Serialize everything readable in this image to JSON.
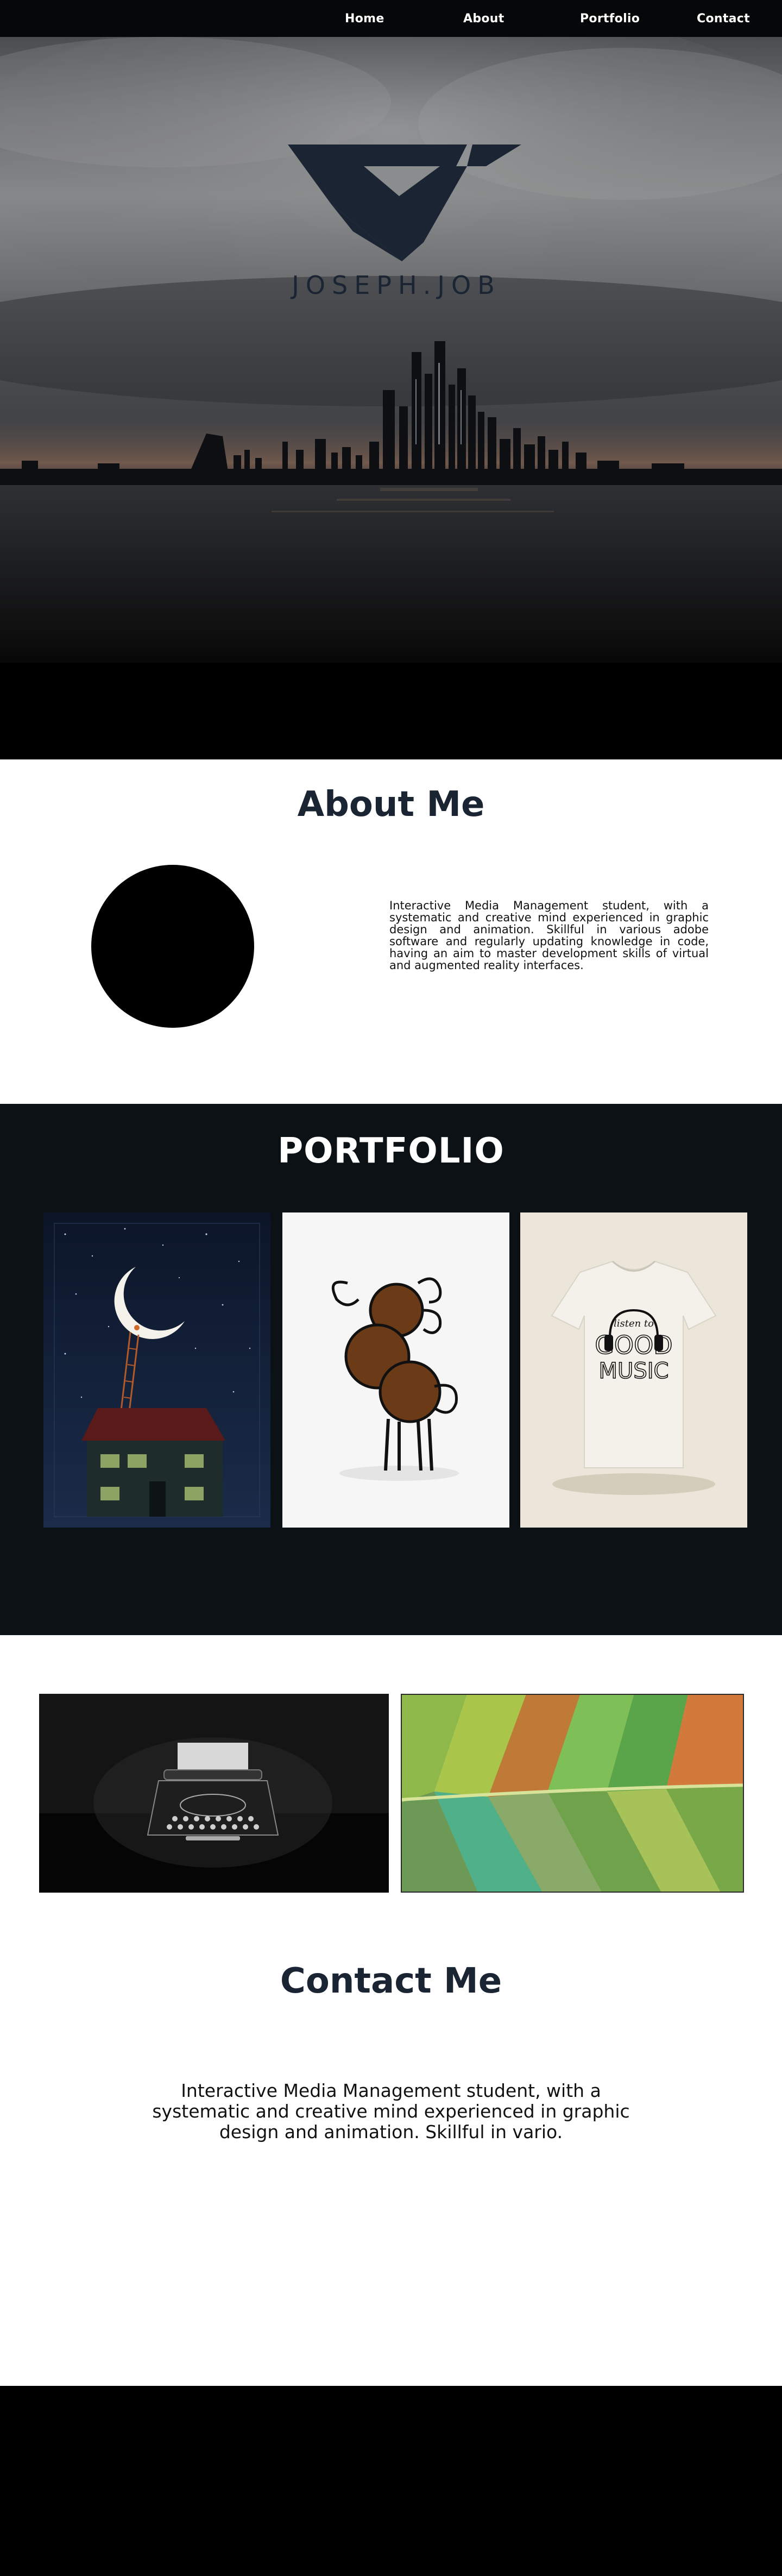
{
  "nav": {
    "items": [
      {
        "label": "Home"
      },
      {
        "label": "About"
      },
      {
        "label": "Portfolio"
      },
      {
        "label": "Contact"
      }
    ]
  },
  "hero": {
    "brand_name": "JOSEPH.JOB",
    "logo_icon": "jj-monogram-logo",
    "colors": {
      "logo": "#1a2433"
    }
  },
  "about": {
    "heading": "About Me",
    "bio": "Interactive Media Management student, with a systematic and creative mind experienced in graphic design and animation. Skillful in various adobe software and regularly updating knowledge in code, having an aim to master development skills of virtual and augmented reality interfaces."
  },
  "portfolio": {
    "heading": "PORTFOLIO",
    "items": [
      {
        "name": "moon-house-illustration"
      },
      {
        "name": "curly-character-illustration"
      },
      {
        "name": "good-music-tshirt"
      }
    ],
    "tshirt_text": {
      "line1": "listen to",
      "line2": "GOOD",
      "line3": "MUSIC"
    }
  },
  "gallery": {
    "items": [
      {
        "name": "typewriter-photo"
      },
      {
        "name": "leaf-closeup-photo"
      }
    ]
  },
  "contact": {
    "heading": "Contact Me",
    "text": "Interactive Media Management student, with a systematic and creative mind experienced in graphic design and animation. Skillful in vario."
  },
  "colors": {
    "nav_bg": "#050708",
    "heading": "#1a2433",
    "portfolio_bg": "#0b1114",
    "footer_bg": "#000000"
  }
}
